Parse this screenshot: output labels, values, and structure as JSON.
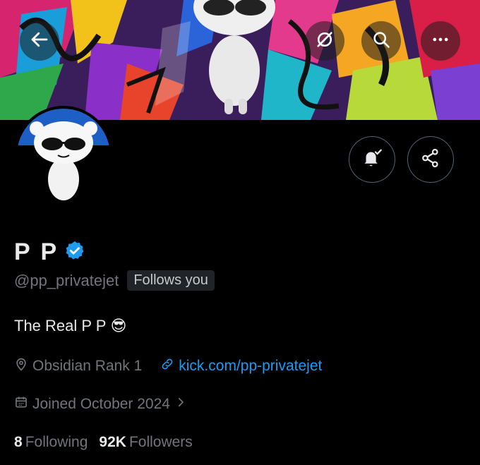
{
  "profile": {
    "display_name": "P P",
    "handle": "@pp_privatejet",
    "follows_you_badge": "Follows you",
    "bio": "The Real P P",
    "bio_emoji": "😎",
    "location": "Obsidian Rank 1",
    "website": "kick.com/pp-privatejet",
    "joined": "Joined October 2024",
    "following_count": "8",
    "following_label": "Following",
    "followers_count": "92K",
    "followers_label": "Followers"
  },
  "icons": {
    "back": "arrow-left-icon",
    "hide": "eye-slash-icon",
    "search": "search-icon",
    "more": "more-dots-icon",
    "notify": "bell-check-icon",
    "share": "share-icon",
    "verified": "verified-badge-icon",
    "location": "location-pin-icon",
    "link": "link-icon",
    "calendar": "calendar-icon",
    "chevron": "chevron-right-icon"
  },
  "colors": {
    "background": "#000000",
    "accent_link": "#1d9bf0",
    "verified": "#1d9bf0",
    "muted_text": "#71767b"
  }
}
